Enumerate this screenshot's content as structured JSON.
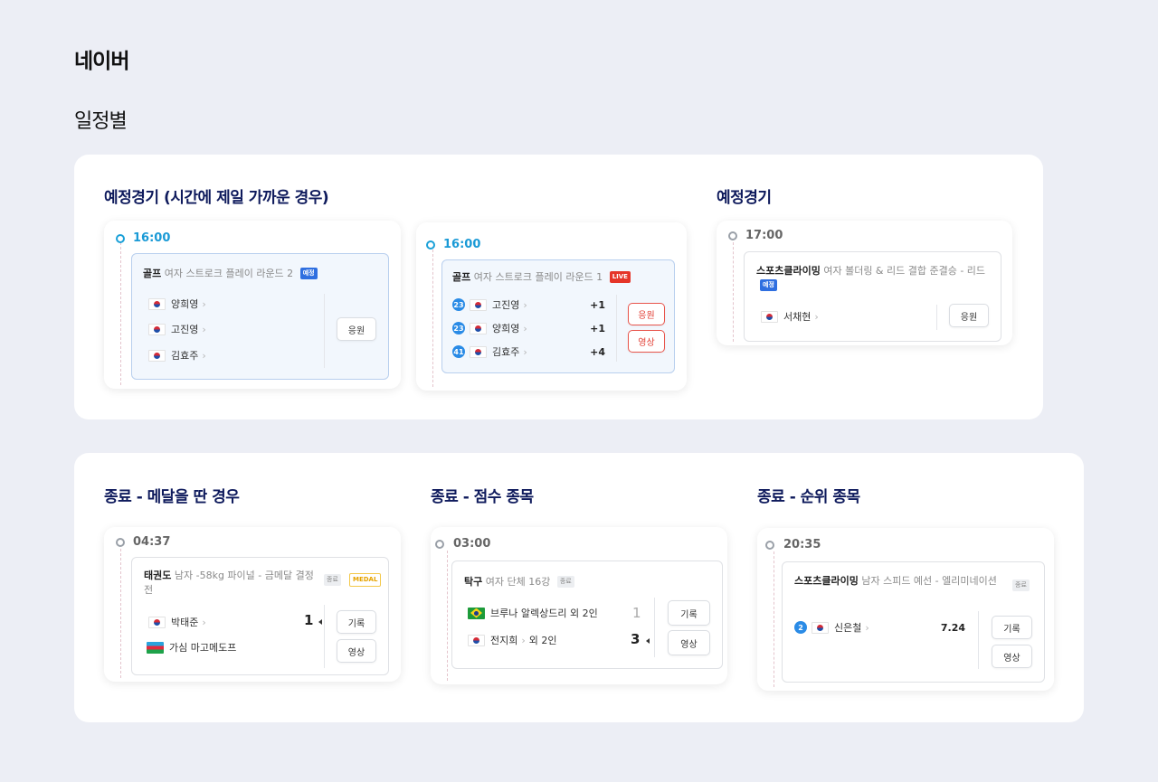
{
  "brand": "네이버",
  "subtitle": "일정별",
  "sections": {
    "upcoming_nearest": "예정경기 (시간에 제일 가까운 경우)",
    "upcoming": "예정경기",
    "ended_medal": "종료 - 메달을 딴 경우",
    "ended_score": "종료 - 점수 종목",
    "ended_rank": "종료 - 순위 종목"
  },
  "card1": {
    "time": "16:00",
    "sport": "골프",
    "event": "여자 스트로크 플레이 라운드 2",
    "badge": "예정",
    "players": [
      "양희영",
      "고진영",
      "김효주"
    ],
    "button": "응원"
  },
  "card2": {
    "time": "16:00",
    "sport": "골프",
    "event": "여자 스트로크 플레이 라운드 1",
    "badge": "LIVE",
    "players": [
      {
        "rank": "23",
        "name": "고진영",
        "score": "+1"
      },
      {
        "rank": "23",
        "name": "양희영",
        "score": "+1"
      },
      {
        "rank": "41",
        "name": "김효주",
        "score": "+4"
      }
    ],
    "button_cheer": "응원",
    "button_video": "영상"
  },
  "card3": {
    "time": "17:00",
    "sport": "스포츠클라이밍",
    "event": "여자 볼더링 & 리드 결합 준결승 - 리드",
    "badge": "예정",
    "player": "서채현",
    "button": "응원"
  },
  "card4": {
    "time": "04:37",
    "sport": "태권도",
    "event": "남자 -58kg 파이널 - 금메달 결정전",
    "badge_end": "종료",
    "badge_medal": "MEDAL",
    "player1": "박태준",
    "player2": "가심 마고메도프",
    "score1": "1",
    "button_record": "기록",
    "button_video": "영상"
  },
  "card5": {
    "time": "03:00",
    "sport": "탁구",
    "event": "여자 단체 16강",
    "badge_end": "종료",
    "team1": "브루나 알렉상드리 외 2인",
    "team2_name": "전지희",
    "team2_suffix": "외 2인",
    "score1": "1",
    "score2": "3",
    "button_record": "기록",
    "button_video": "영상"
  },
  "card6": {
    "time": "20:35",
    "sport": "스포츠클라이밍",
    "event": "남자 스피드 예선 - 엘리미네이션",
    "badge_end": "종료",
    "rank": "2",
    "player": "신은철",
    "score": "7.24",
    "button_record": "기록",
    "button_video": "영상"
  }
}
